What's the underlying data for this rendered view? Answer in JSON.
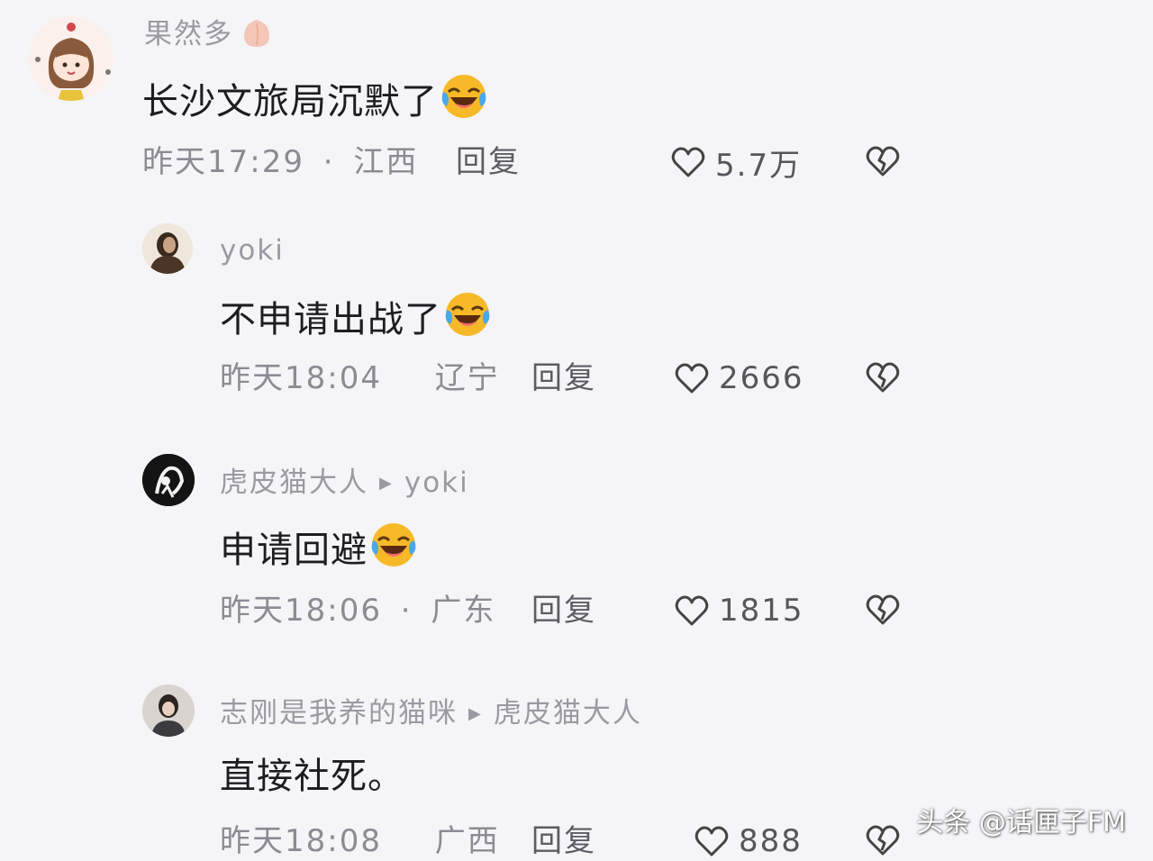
{
  "comments": [
    {
      "username": "果然多",
      "text": "长沙文旅局沉默了",
      "time": "昨天17:29",
      "sep": "·",
      "location": "江西",
      "reply_label": "回复",
      "likes": "5.7万"
    },
    {
      "username": "yoki",
      "text": "不申请出战了",
      "time": "昨天18:04",
      "location": "辽宁",
      "reply_label": "回复",
      "likes": "2666"
    },
    {
      "username": "虎皮猫大人",
      "reply_to": "yoki",
      "text": "申请回避",
      "time": "昨天18:06",
      "sep": "·",
      "location": "广东",
      "reply_label": "回复",
      "likes": "1815"
    },
    {
      "username": "志刚是我养的猫咪",
      "reply_to": "虎皮猫大人",
      "text": "直接社死。",
      "time": "昨天18:08",
      "location": "广西",
      "reply_label": "回复",
      "likes": "888"
    }
  ],
  "watermark": "头条 @话匣子FM",
  "icons": {
    "reply_arrow": "play-triangle-icon",
    "like": "heart-icon",
    "dislike": "broken-heart-icon",
    "emoji": "laughing-tears-emoji"
  },
  "colors": {
    "background": "#f5f5f8",
    "username": "#9a9aa2",
    "text": "#1c1c22",
    "meta": "#8b8b93"
  }
}
